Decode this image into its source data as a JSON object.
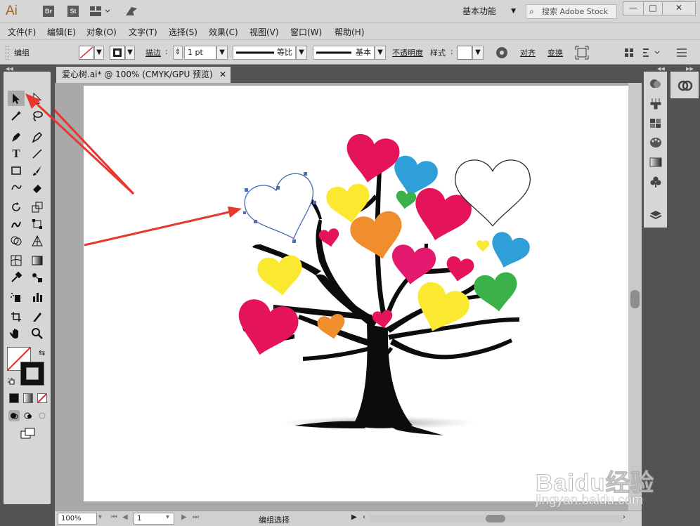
{
  "titlebar": {
    "app_logo": "Ai",
    "bridge": "Br",
    "stock": "St",
    "workspace": "基本功能",
    "stock_search_placeholder": "搜索 Adobe Stock",
    "minimize": "—",
    "maximize": "□",
    "close": "✕"
  },
  "menu": [
    {
      "label": "文件(F)"
    },
    {
      "label": "编辑(E)"
    },
    {
      "label": "对象(O)"
    },
    {
      "label": "文字(T)"
    },
    {
      "label": "选择(S)"
    },
    {
      "label": "效果(C)"
    },
    {
      "label": "视图(V)"
    },
    {
      "label": "窗口(W)"
    },
    {
      "label": "帮助(H)"
    }
  ],
  "control": {
    "selection_label": "编组",
    "stroke_label": "描边",
    "stroke_weight": "1 pt",
    "profile_label": "等比",
    "brush_label": "基本",
    "opacity_label": "不透明度",
    "style_label": "样式",
    "align_label": "对齐",
    "transform_label": "变换"
  },
  "document": {
    "tab_title": "爱心树.ai* @ 100% (CMYK/GPU 预览)",
    "tab_close": "✕"
  },
  "status": {
    "zoom": "100%",
    "artboard": "1",
    "tool_info": "编组选择"
  },
  "colors": {
    "pink": "#e5135a",
    "magenta": "#e4186e",
    "yellow": "#fbe931",
    "orange": "#f08d2c",
    "blue": "#2f9fda",
    "green": "#3bb14a",
    "annotation_red": "#e8382e",
    "selection_blue": "#4a6fb5"
  },
  "icons": {
    "selection_tool": "arrow-icon",
    "direct_selection_tool": "hollow-arrow-icon"
  },
  "watermark": {
    "text": "Baidu经验",
    "sub": "jingyan.baidu.com"
  }
}
